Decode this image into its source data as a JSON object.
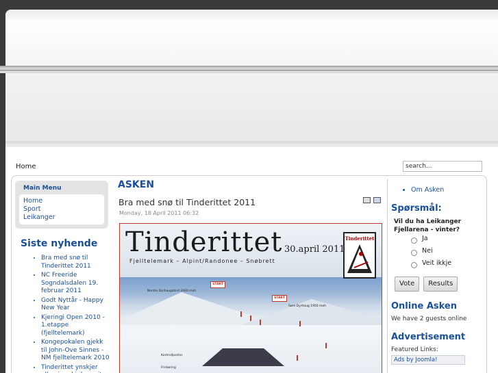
{
  "nav": {
    "breadcrumb": "Home",
    "search_value": "search..."
  },
  "main_menu": {
    "title": "Main Menu",
    "items": [
      "Home",
      "Sport",
      "Leikanger"
    ]
  },
  "siste": {
    "title": "Siste nyhende",
    "items": [
      "Bra med snø til Tinderittet 2011",
      "NC Freeride Sogndalsdalen 19. februar 2011",
      "Godt Nyttår - Happy New Year",
      "Kjeringi Open 2010 - 1.etappe (fjelltelemark)",
      "Kongepokalen gjekk til John-Ove Sinnes - NM fjelltelemark 2010",
      "Tinderittet ynskjer alle ei god jul og eit"
    ]
  },
  "article": {
    "section": "ASKEN",
    "title": "Bra med snø til Tinderittet 2011",
    "date": "Monday, 18 April 2011 06:32"
  },
  "poster": {
    "title": "Tinderittet",
    "date": "30.april 2011",
    "subtitle": "Fjelltelemark  –  Alpint/Randonee  –  Snøbrett",
    "logo_text": "Tinderittet",
    "flags": [
      "START",
      "START"
    ],
    "notes": [
      "Nordre Dyrhaugstind 2060 moh",
      "Søre Dyrhaug 1950 moh",
      "Kontrollpostar",
      "Friskøring"
    ]
  },
  "right": {
    "links": [
      "Om Asken"
    ],
    "poll": {
      "title": "Spørsmål:",
      "question": "Vil du ha Leikanger Fjellarena - vinter?",
      "options": [
        "Ja",
        "Nei",
        "Veit ikkje"
      ],
      "vote_label": "Vote",
      "results_label": "Results"
    },
    "online": {
      "title": "Online Asken",
      "text": "We have 2 guests online"
    },
    "ads": {
      "title": "Advertisement",
      "featured": "Featured Links:",
      "link": "Ads by Joomla!"
    }
  },
  "colors": {
    "link": "#1a4f9c",
    "background": "#3a3a3a"
  }
}
